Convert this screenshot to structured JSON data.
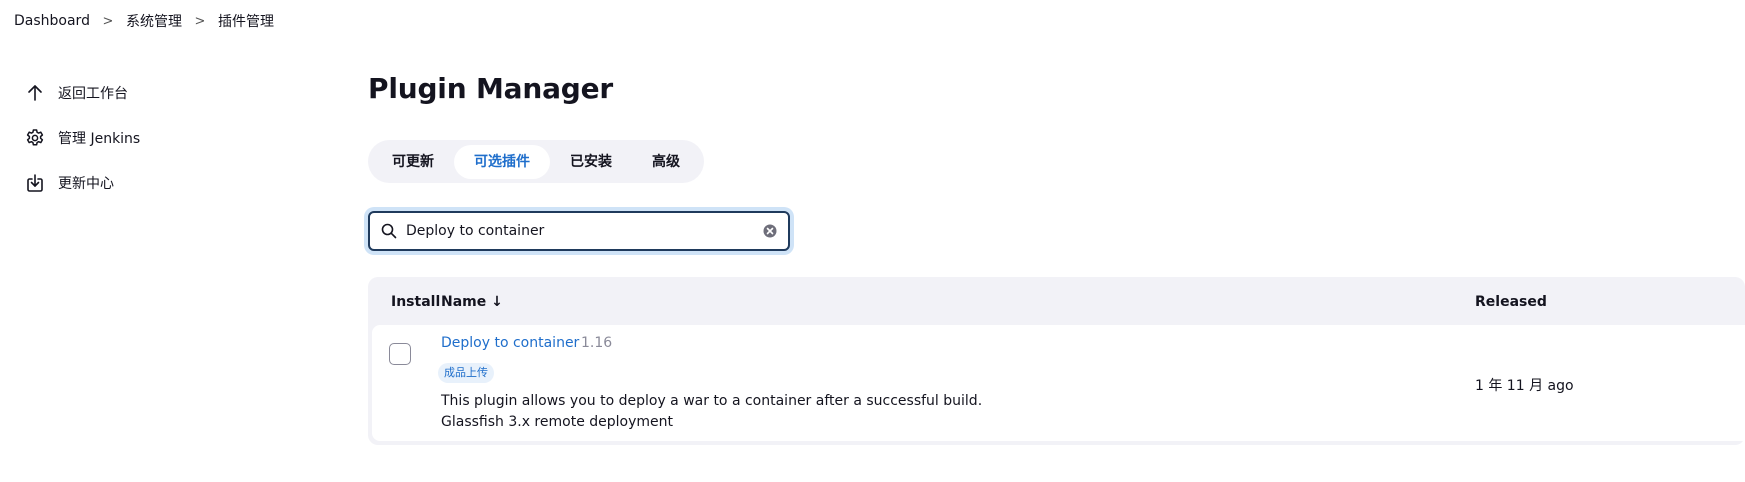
{
  "breadcrumb": {
    "items": [
      "Dashboard",
      "系统管理",
      "插件管理"
    ],
    "separator": ">"
  },
  "sidebar": {
    "items": [
      {
        "label": "返回工作台",
        "icon": "arrow-up-icon"
      },
      {
        "label": "管理 Jenkins",
        "icon": "gear-icon"
      },
      {
        "label": "更新中心",
        "icon": "download-icon"
      }
    ]
  },
  "main": {
    "title": "Plugin Manager",
    "tabs": [
      {
        "label": "可更新",
        "active": false
      },
      {
        "label": "可选插件",
        "active": true
      },
      {
        "label": "已安装",
        "active": false
      },
      {
        "label": "高级",
        "active": false
      }
    ],
    "search": {
      "value": "Deploy to container",
      "placeholder": ""
    },
    "table": {
      "headers": {
        "install": "Install",
        "name": "Name ↓",
        "released": "Released"
      },
      "rows": [
        {
          "checked": false,
          "name": "Deploy to container",
          "version": "1.16",
          "tag": "成品上传",
          "description_line1": "This plugin allows you to deploy a war to a container after a successful build.",
          "description_line2": "Glassfish 3.x remote deployment",
          "released": "1 年 11 月 ago"
        }
      ]
    }
  },
  "colors": {
    "accent": "#1f6ecb",
    "text": "#14141f",
    "panel_bg": "#f2f2f7",
    "muted": "#8a8a99"
  }
}
